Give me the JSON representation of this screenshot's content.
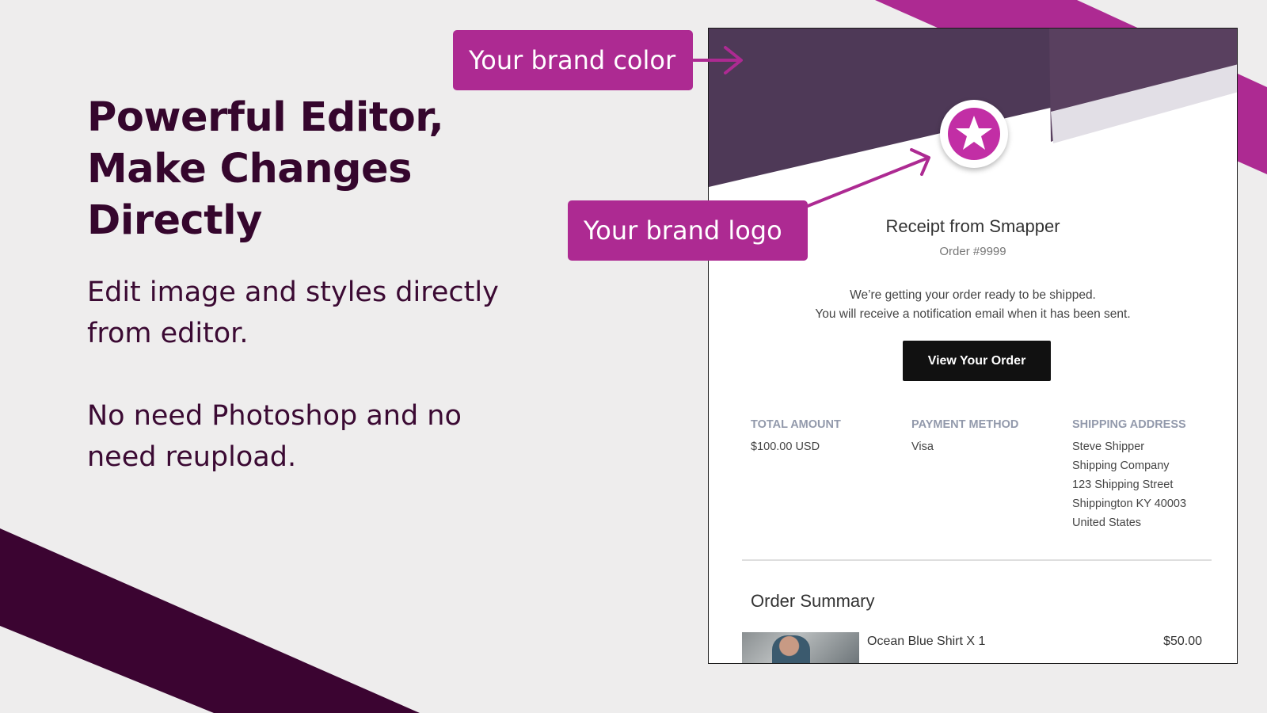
{
  "colors": {
    "background": "#eeeded",
    "dark_plum": "#35062d",
    "magenta": "#ad2a92",
    "header_purple": "#4e3957",
    "logo_magenta": "#c22ea5"
  },
  "hero": {
    "headline": [
      "Powerful Editor,",
      "Make Changes",
      "Directly"
    ],
    "paragraph1": "Edit image and styles directly from editor.",
    "paragraph2": "No need Photoshop and no need reupload."
  },
  "callouts": {
    "brand_color": "Your brand color",
    "brand_logo": "Your brand logo"
  },
  "email": {
    "logo_icon": "star-icon",
    "title": "Receipt from Smapper",
    "order_number": "Order #9999",
    "message_line1": "We’re getting your order ready to be shipped.",
    "message_line2": "You will receive a notification email when it has been sent.",
    "view_order_button": "View Your Order",
    "total_amount": {
      "label": "TOTAL AMOUNT",
      "value": "$100.00 USD"
    },
    "payment_method": {
      "label": "PAYMENT METHOD",
      "value": "Visa"
    },
    "shipping_address": {
      "label": "SHIPPING ADDRESS",
      "lines": [
        "Steve Shipper",
        "Shipping Company",
        "123 Shipping Street",
        "Shippington KY 40003",
        "United States"
      ]
    },
    "order_summary": {
      "title": "Order Summary",
      "items": [
        {
          "name": "Ocean Blue Shirt X 1",
          "price": "$50.00"
        }
      ]
    }
  }
}
